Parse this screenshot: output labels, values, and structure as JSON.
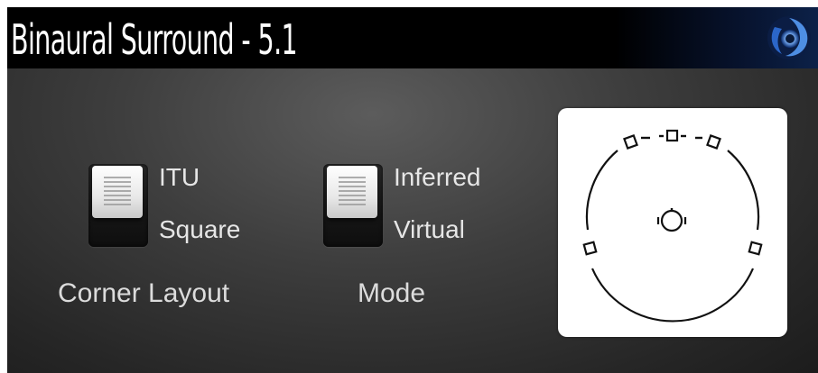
{
  "window": {
    "title": "Binaural Surround - 5.1"
  },
  "header": {
    "logo_icon": "swirl-logo-icon"
  },
  "controls": {
    "corner_layout": {
      "option_top": "ITU",
      "option_bottom": "Square",
      "caption": "Corner Layout",
      "selected": "ITU"
    },
    "mode": {
      "option_top": "Inferred",
      "option_bottom": "Virtual",
      "caption": "Mode",
      "selected": "Inferred"
    }
  },
  "speaker_display": {
    "icons": [
      "speaker-icon",
      "listener-head-icon"
    ]
  },
  "colors": {
    "header_bg": "#000000",
    "panel_bg": "#3a3a3a",
    "text": "#e6e6e6",
    "display_bg": "#ffffff"
  }
}
